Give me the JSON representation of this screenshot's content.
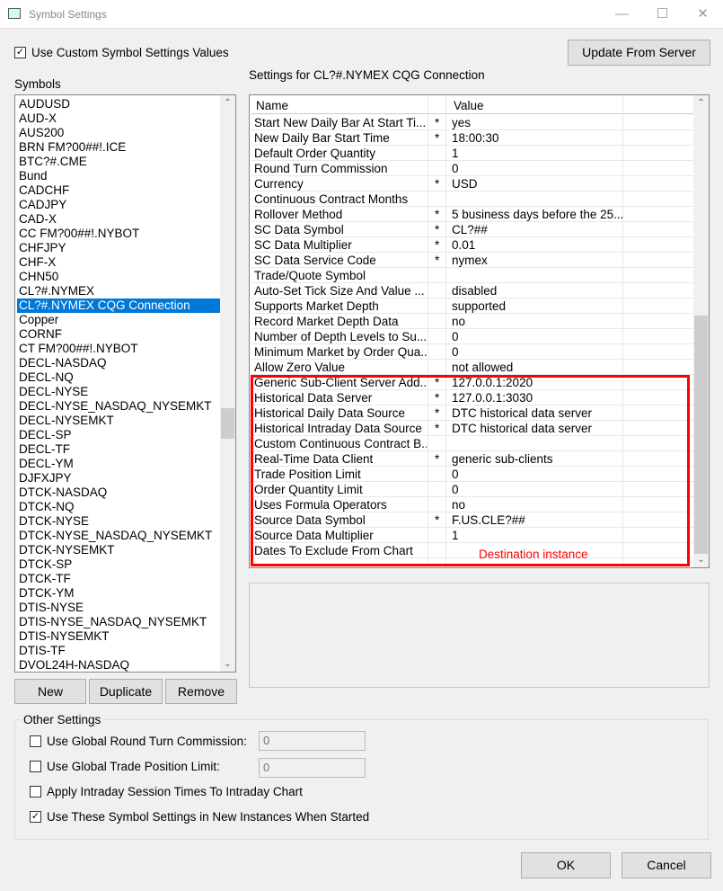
{
  "window": {
    "title": "Symbol Settings",
    "controls": [
      "minimize",
      "maximize",
      "close"
    ]
  },
  "use_custom": {
    "label": "Use Custom Symbol Settings Values",
    "checked": true
  },
  "update_button": "Update From Server",
  "symbols_label": "Symbols",
  "settings_title": "Settings for CL?#.NYMEX CQG Connection",
  "symbols": [
    "AUDUSD",
    "AUD-X",
    "AUS200",
    "BRN FM?00##!.ICE",
    "BTC?#.CME",
    "Bund",
    "CADCHF",
    "CADJPY",
    "CAD-X",
    "CC  FM?00##!.NYBOT",
    "CHFJPY",
    "CHF-X",
    "CHN50",
    "CL?#.NYMEX",
    "CL?#.NYMEX CQG Connection",
    "Copper",
    "CORNF",
    "CT  FM?00##!.NYBOT",
    "DECL-NASDAQ",
    "DECL-NQ",
    "DECL-NYSE",
    "DECL-NYSE_NASDAQ_NYSEMKT",
    "DECL-NYSEMKT",
    "DECL-SP",
    "DECL-TF",
    "DECL-YM",
    "DJFXJPY",
    "DTCK-NASDAQ",
    "DTCK-NQ",
    "DTCK-NYSE",
    "DTCK-NYSE_NASDAQ_NYSEMKT",
    "DTCK-NYSEMKT",
    "DTCK-SP",
    "DTCK-TF",
    "DTCK-YM",
    "DTIS-NYSE",
    "DTIS-NYSE_NASDAQ_NYSEMKT",
    "DTIS-NYSEMKT",
    "DTIS-TF",
    "DVOL24H-NASDAQ"
  ],
  "selected_symbol": "CL?#.NYMEX CQG Connection",
  "list_buttons": {
    "new": "New",
    "duplicate": "Duplicate",
    "remove": "Remove"
  },
  "grid": {
    "headers": {
      "name": "Name",
      "value": "Value"
    },
    "rows": [
      {
        "name": "Start New Daily Bar At Start Ti...",
        "star": "*",
        "value": "yes"
      },
      {
        "name": "New Daily Bar Start Time",
        "star": "*",
        "value": "18:00:30"
      },
      {
        "name": "Default Order Quantity",
        "star": "",
        "value": "1"
      },
      {
        "name": "Round Turn Commission",
        "star": "",
        "value": "0"
      },
      {
        "name": "Currency",
        "star": "*",
        "value": "USD"
      },
      {
        "name": "Continuous Contract Months",
        "star": "",
        "value": ""
      },
      {
        "name": "Rollover Method",
        "star": "*",
        "value": "5 business days before the 25..."
      },
      {
        "name": "SC Data Symbol",
        "star": "*",
        "value": "CL?##"
      },
      {
        "name": "SC Data Multiplier",
        "star": "*",
        "value": "0.01"
      },
      {
        "name": "SC Data Service Code",
        "star": "*",
        "value": "nymex"
      },
      {
        "name": "Trade/Quote Symbol",
        "star": "",
        "value": ""
      },
      {
        "name": "Auto-Set Tick Size And Value ...",
        "star": "",
        "value": "disabled"
      },
      {
        "name": "Supports Market Depth",
        "star": "",
        "value": "supported"
      },
      {
        "name": "Record Market Depth Data",
        "star": "",
        "value": "no"
      },
      {
        "name": "Number of Depth Levels to Su...",
        "star": "",
        "value": "0"
      },
      {
        "name": "Minimum Market by Order Qua...",
        "star": "",
        "value": "0"
      },
      {
        "name": "Allow Zero Value",
        "star": "",
        "value": "not allowed"
      },
      {
        "name": "Generic Sub-Client Server Add...",
        "star": "*",
        "value": "127.0.0.1:2020"
      },
      {
        "name": "Historical Data Server",
        "star": "*",
        "value": "127.0.0.1:3030"
      },
      {
        "name": "Historical Daily Data Source",
        "star": "*",
        "value": "DTC historical data server"
      },
      {
        "name": "Historical Intraday Data Source",
        "star": "*",
        "value": "DTC historical data server"
      },
      {
        "name": "Custom Continuous Contract B...",
        "star": "",
        "value": ""
      },
      {
        "name": "Real-Time Data Client",
        "star": "*",
        "value": "generic sub-clients"
      },
      {
        "name": "Trade Position Limit",
        "star": "",
        "value": "0"
      },
      {
        "name": "Order Quantity Limit",
        "star": "",
        "value": "0"
      },
      {
        "name": "Uses Formula Operators",
        "star": "",
        "value": "no"
      },
      {
        "name": "Source Data Symbol",
        "star": "*",
        "value": "F.US.CLE?##"
      },
      {
        "name": "Source Data Multiplier",
        "star": "",
        "value": "1"
      },
      {
        "name": "Dates To Exclude From Chart",
        "star": "",
        "value": ""
      }
    ]
  },
  "annotation": {
    "text": "Destination instance",
    "color": "#ff0000"
  },
  "other_settings": {
    "title": "Other Settings",
    "use_global_rtc": {
      "label": "Use Global Round Turn Commission:",
      "checked": false,
      "value": "0"
    },
    "use_global_tpl": {
      "label": "Use Global Trade Position Limit:",
      "checked": false,
      "value": "0"
    },
    "apply_intraday": {
      "label": "Apply Intraday Session Times To Intraday Chart",
      "checked": false
    },
    "use_in_new": {
      "label": "Use These Symbol Settings in New Instances When Started",
      "checked": true
    }
  },
  "ok": "OK",
  "cancel": "Cancel",
  "colors": {
    "selection": "#0078d7",
    "highlight_box": "#ff0000"
  }
}
